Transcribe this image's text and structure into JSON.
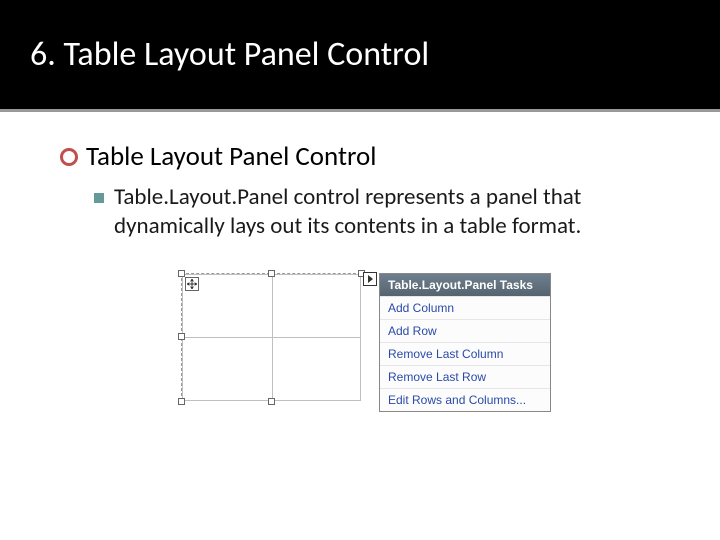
{
  "slide": {
    "title": "6. Table Layout Panel Control",
    "bullet1": "Table Layout Panel Control",
    "bullet2": "Table.Layout.Panel control represents a panel that dynamically lays out its contents in a table format."
  },
  "tasks": {
    "header": "Table.Layout.Panel Tasks",
    "items": [
      "Add Column",
      "Add Row",
      "Remove Last Column",
      "Remove Last Row",
      "Edit Rows and Columns..."
    ]
  }
}
